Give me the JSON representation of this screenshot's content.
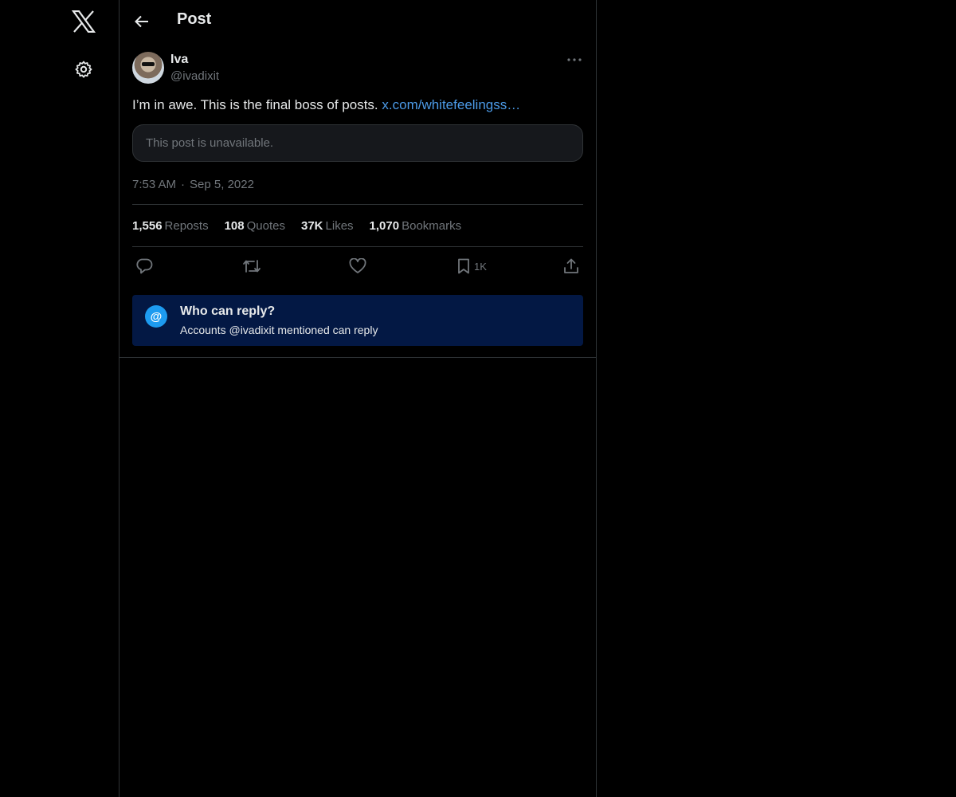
{
  "header": {
    "title": "Post"
  },
  "post": {
    "author_name": "Iva",
    "author_handle": "@ivadixit",
    "text": "I’m in awe. This is the final boss of posts.",
    "link": "x.com/whitefeelingss…",
    "quoted_unavailable": "This post is unavailable.",
    "time": "7:53 AM",
    "date": "Sep 5, 2022",
    "stats": {
      "reposts_count": "1,556",
      "reposts_label": "Reposts",
      "quotes_count": "108",
      "quotes_label": "Quotes",
      "likes_count": "37K",
      "likes_label": "Likes",
      "bookmarks_count": "1,070",
      "bookmarks_label": "Bookmarks"
    },
    "actions": {
      "bookmark_count": "1K"
    }
  },
  "reply_notice": {
    "icon_glyph": "@",
    "title": "Who can reply?",
    "subtitle": "Accounts @ivadixit mentioned can reply"
  },
  "icons": {
    "logo": "x-logo-icon",
    "settings": "gear-icon",
    "back": "arrow-left-icon",
    "more": "more-dots-icon",
    "reply": "reply-icon",
    "repost": "repost-icon",
    "like": "heart-icon",
    "bookmark": "bookmark-icon",
    "share": "share-icon"
  },
  "colors": {
    "background": "#000000",
    "text": "#e7e9ea",
    "muted": "#71767b",
    "link": "#4c9be8",
    "accent": "#1d9bf0",
    "reply_box": "#031844",
    "border": "#2f3336"
  }
}
